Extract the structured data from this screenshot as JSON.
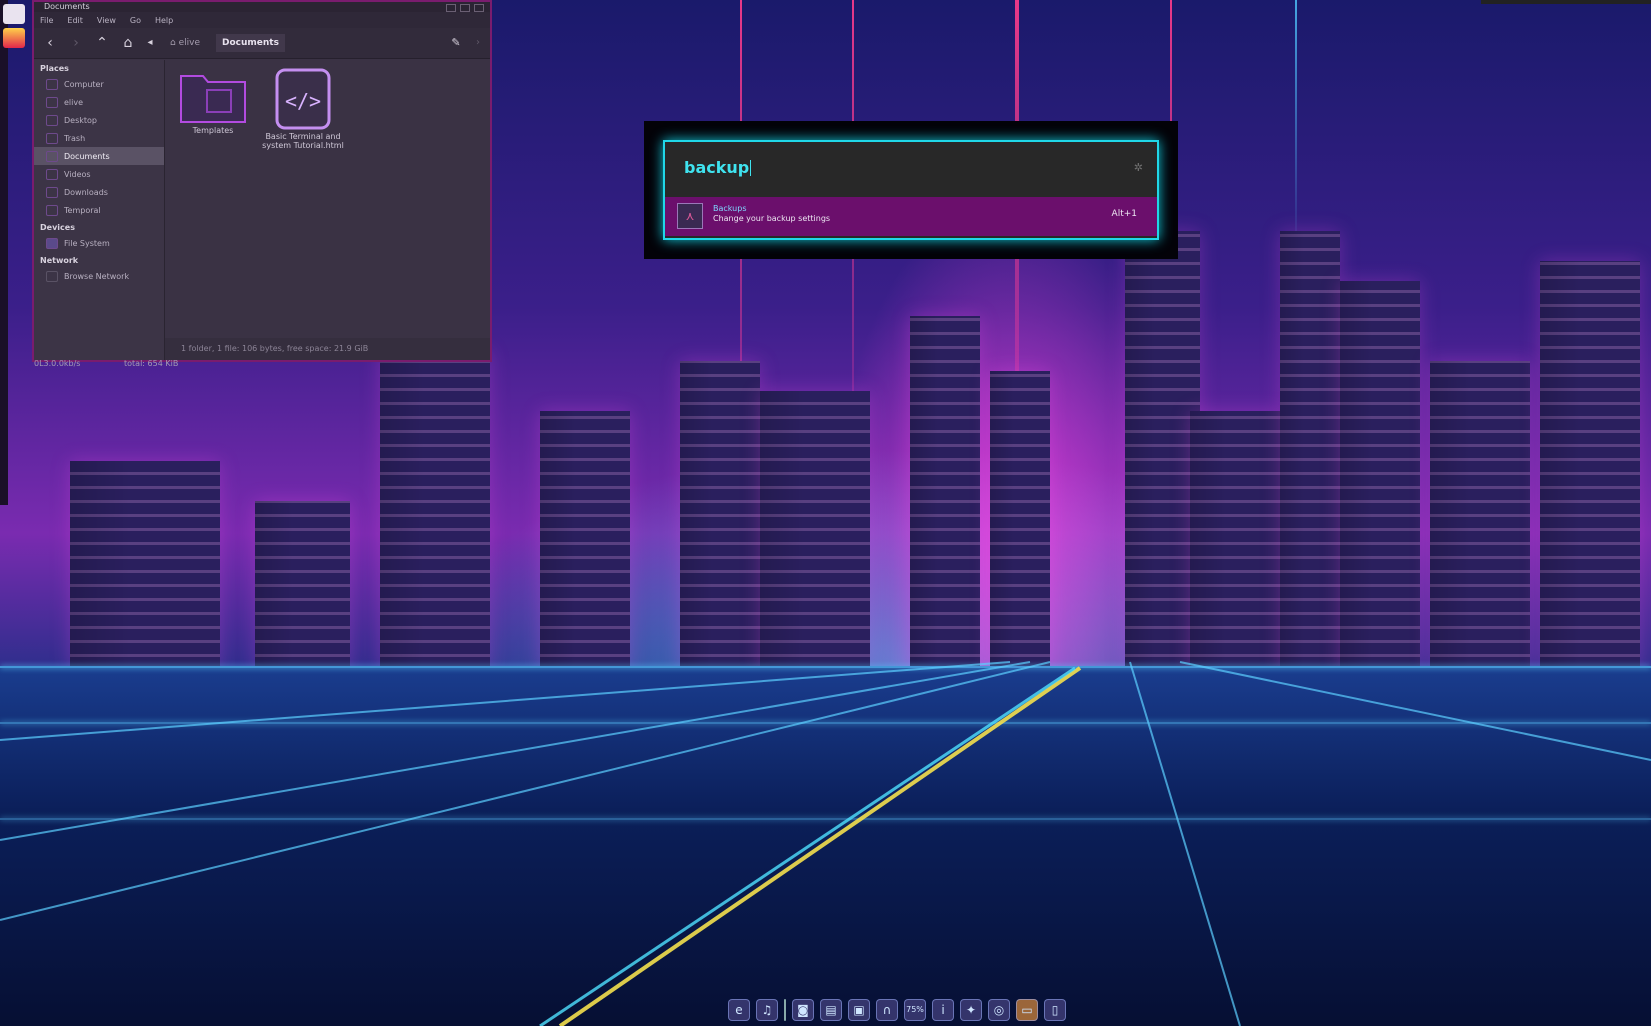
{
  "file_manager": {
    "title": "Documents",
    "menu": [
      "File",
      "Edit",
      "View",
      "Go",
      "Help"
    ],
    "breadcrumb": [
      "elive",
      "Documents"
    ],
    "sidebar": {
      "places_heading": "Places",
      "places": [
        "Computer",
        "elive",
        "Desktop",
        "Trash",
        "Documents",
        "Videos",
        "Downloads",
        "Temporal"
      ],
      "selected": "Documents",
      "devices_heading": "Devices",
      "devices": [
        "File System"
      ],
      "network_heading": "Network",
      "network": [
        "Browse Network"
      ]
    },
    "files": [
      {
        "name": "Templates",
        "icon": "folder-icon"
      },
      {
        "name": "Basic Terminal and system Tutorial.html",
        "icon": "code-file-icon"
      }
    ],
    "status": "1 folder, 1 file: 106 bytes, free space: 21.9 GiB"
  },
  "desktop_overflow": {
    "left": "0L3.0.0kb/s",
    "right": "total: 654 KiB"
  },
  "launcher": {
    "query": "backup",
    "result_name": "Backups",
    "result_desc": "Change your backup settings",
    "result_shortcut": "Alt+1"
  },
  "dock": {
    "icons": [
      "browser-icon",
      "music-icon",
      "camera-icon",
      "clipboard-icon",
      "photo-icon",
      "headphones-icon",
      "battery-icon",
      "info-icon",
      "tools-icon",
      "network-icon",
      "folder-icon",
      "trash-icon"
    ],
    "battery_label": "75%"
  },
  "colors": {
    "accent": "#20d7e8",
    "result_bg": "#6b0f6c",
    "window_border": "#7a1c6e"
  }
}
